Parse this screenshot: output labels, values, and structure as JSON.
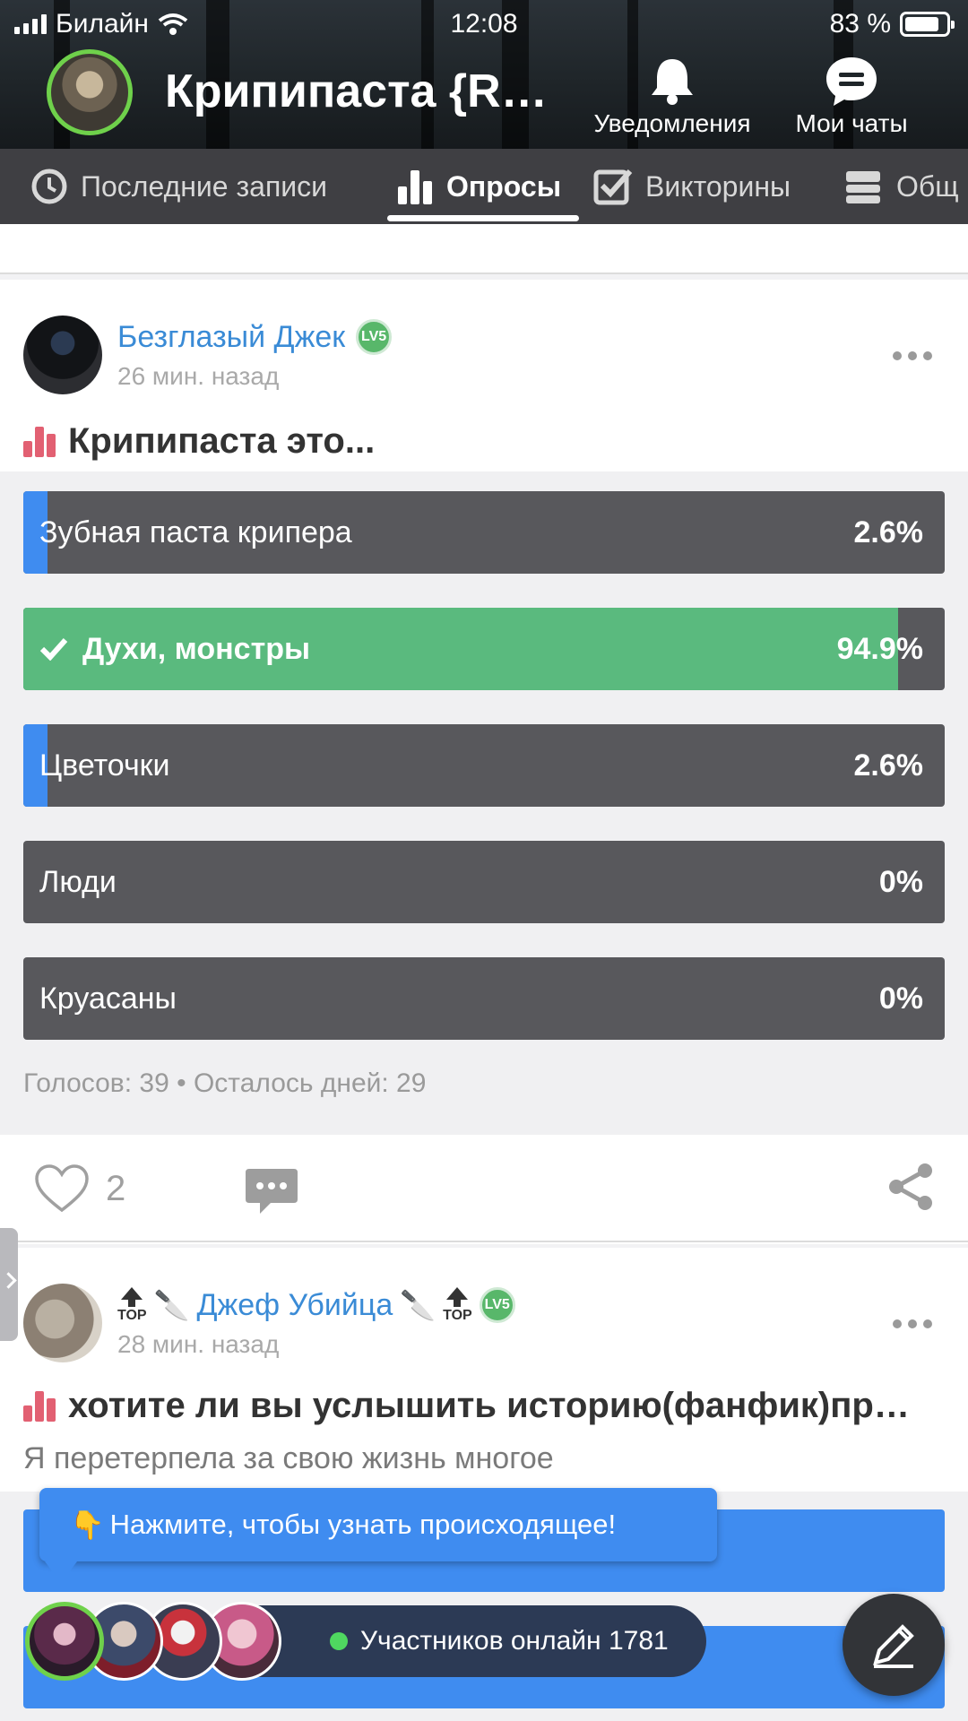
{
  "status_bar": {
    "carrier": "Билайн",
    "time": "12:08",
    "battery": "83 %"
  },
  "header": {
    "community_title": "Крипипаста {R…",
    "notifications_label": "Уведомления",
    "chats_label": "Мои чаты"
  },
  "tabs": [
    {
      "label": "Последние записи",
      "icon": "clock-icon"
    },
    {
      "label": "Опросы",
      "icon": "bar-chart-icon",
      "active": true
    },
    {
      "label": "Викторины",
      "icon": "checkbox-icon"
    },
    {
      "label": "Общ",
      "icon": "stack-icon"
    }
  ],
  "post1": {
    "author": "Безглазый Джек",
    "level": "LV5",
    "time": "26 мин. назад",
    "title": "Крипипаста это...",
    "options": [
      {
        "label": "Зубная паста крипера",
        "percent": "2.6%",
        "fraction": 0.026
      },
      {
        "label": "Духи, монстры",
        "percent": "94.9%",
        "fraction": 0.949,
        "voted": true
      },
      {
        "label": "Цветочки",
        "percent": "2.6%",
        "fraction": 0.026
      },
      {
        "label": "Люди",
        "percent": "0%",
        "fraction": 0
      },
      {
        "label": "Круасаны",
        "percent": "0%",
        "fraction": 0
      }
    ],
    "meta": "Голосов: 39 • Осталось дней: 29",
    "likes": "2"
  },
  "post2": {
    "author": "Джеф Убийца",
    "level": "LV5",
    "top_label": "TOP",
    "time": "28 мин. назад",
    "title": "хотите ли вы услышить историю(фанфик)пр…",
    "preview": "Я перетерпела за свою жизнь многое"
  },
  "tooltip": {
    "text": "Нажмите, чтобы узнать происходящее!",
    "icon": "👇"
  },
  "online": {
    "text": "Участников онлайн 1781"
  },
  "colors": {
    "accent_blue": "#3f8cf0",
    "poll_green": "#5aba7e",
    "poll_dark": "#58585c",
    "link_blue": "#3a8bd6"
  }
}
